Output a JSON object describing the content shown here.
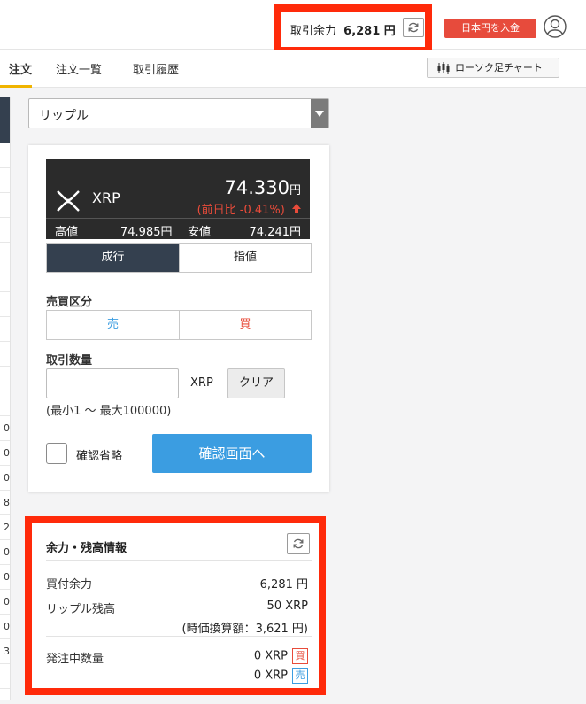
{
  "header": {
    "balance_label": "取引余力",
    "balance_value": "6,281 円",
    "deposit_label": "日本円を入金"
  },
  "tabs": {
    "active": "注文",
    "order_list": "注文一覧",
    "history": "取引履歴",
    "candle_chart": "ローソク足チャート"
  },
  "left_strip": {
    "rows": [
      "",
      "",
      "",
      "",
      "",
      "",
      "",
      "",
      "",
      "",
      "",
      "0",
      "0",
      "0",
      "8",
      "2",
      "0",
      "0",
      "0",
      "0",
      "3",
      "",
      ""
    ]
  },
  "currency_select": {
    "value": "リップル"
  },
  "ticker": {
    "symbol": "XRP",
    "price": "74.330",
    "price_unit": "円",
    "change": "(前日比 -0.41%)",
    "high_label": "高値",
    "high_value": "74.985円",
    "low_label": "安値",
    "low_value": "74.241円"
  },
  "order_type": {
    "market": "成行",
    "limit": "指値"
  },
  "side": {
    "label": "売買区分",
    "sell": "売",
    "buy": "買"
  },
  "quantity": {
    "label": "取引数量",
    "value": "",
    "unit": "XRP",
    "clear": "クリア",
    "range": "(最小1 〜 最大100000)"
  },
  "confirm": {
    "skip_label": "確認省略",
    "button": "確認画面へ"
  },
  "info": {
    "title": "余力・残高情報",
    "buying_power_label": "買付余力",
    "buying_power_value": "6,281 円",
    "ripple_balance_label": "リップル残高",
    "ripple_balance_value": "50 XRP",
    "ripple_balance_jpy": "(時価換算額：3,621 円)",
    "pending_label": "発注中数量",
    "pending_buy": "0 XRP",
    "pending_sell": "0 XRP",
    "buy_tag": "買",
    "sell_tag": "売"
  },
  "colors": {
    "highlight": "#ff2a0a",
    "deposit": "#e74b3c",
    "primary": "#3b9de1",
    "dark": "#34404f",
    "down": "#e84b3a"
  }
}
